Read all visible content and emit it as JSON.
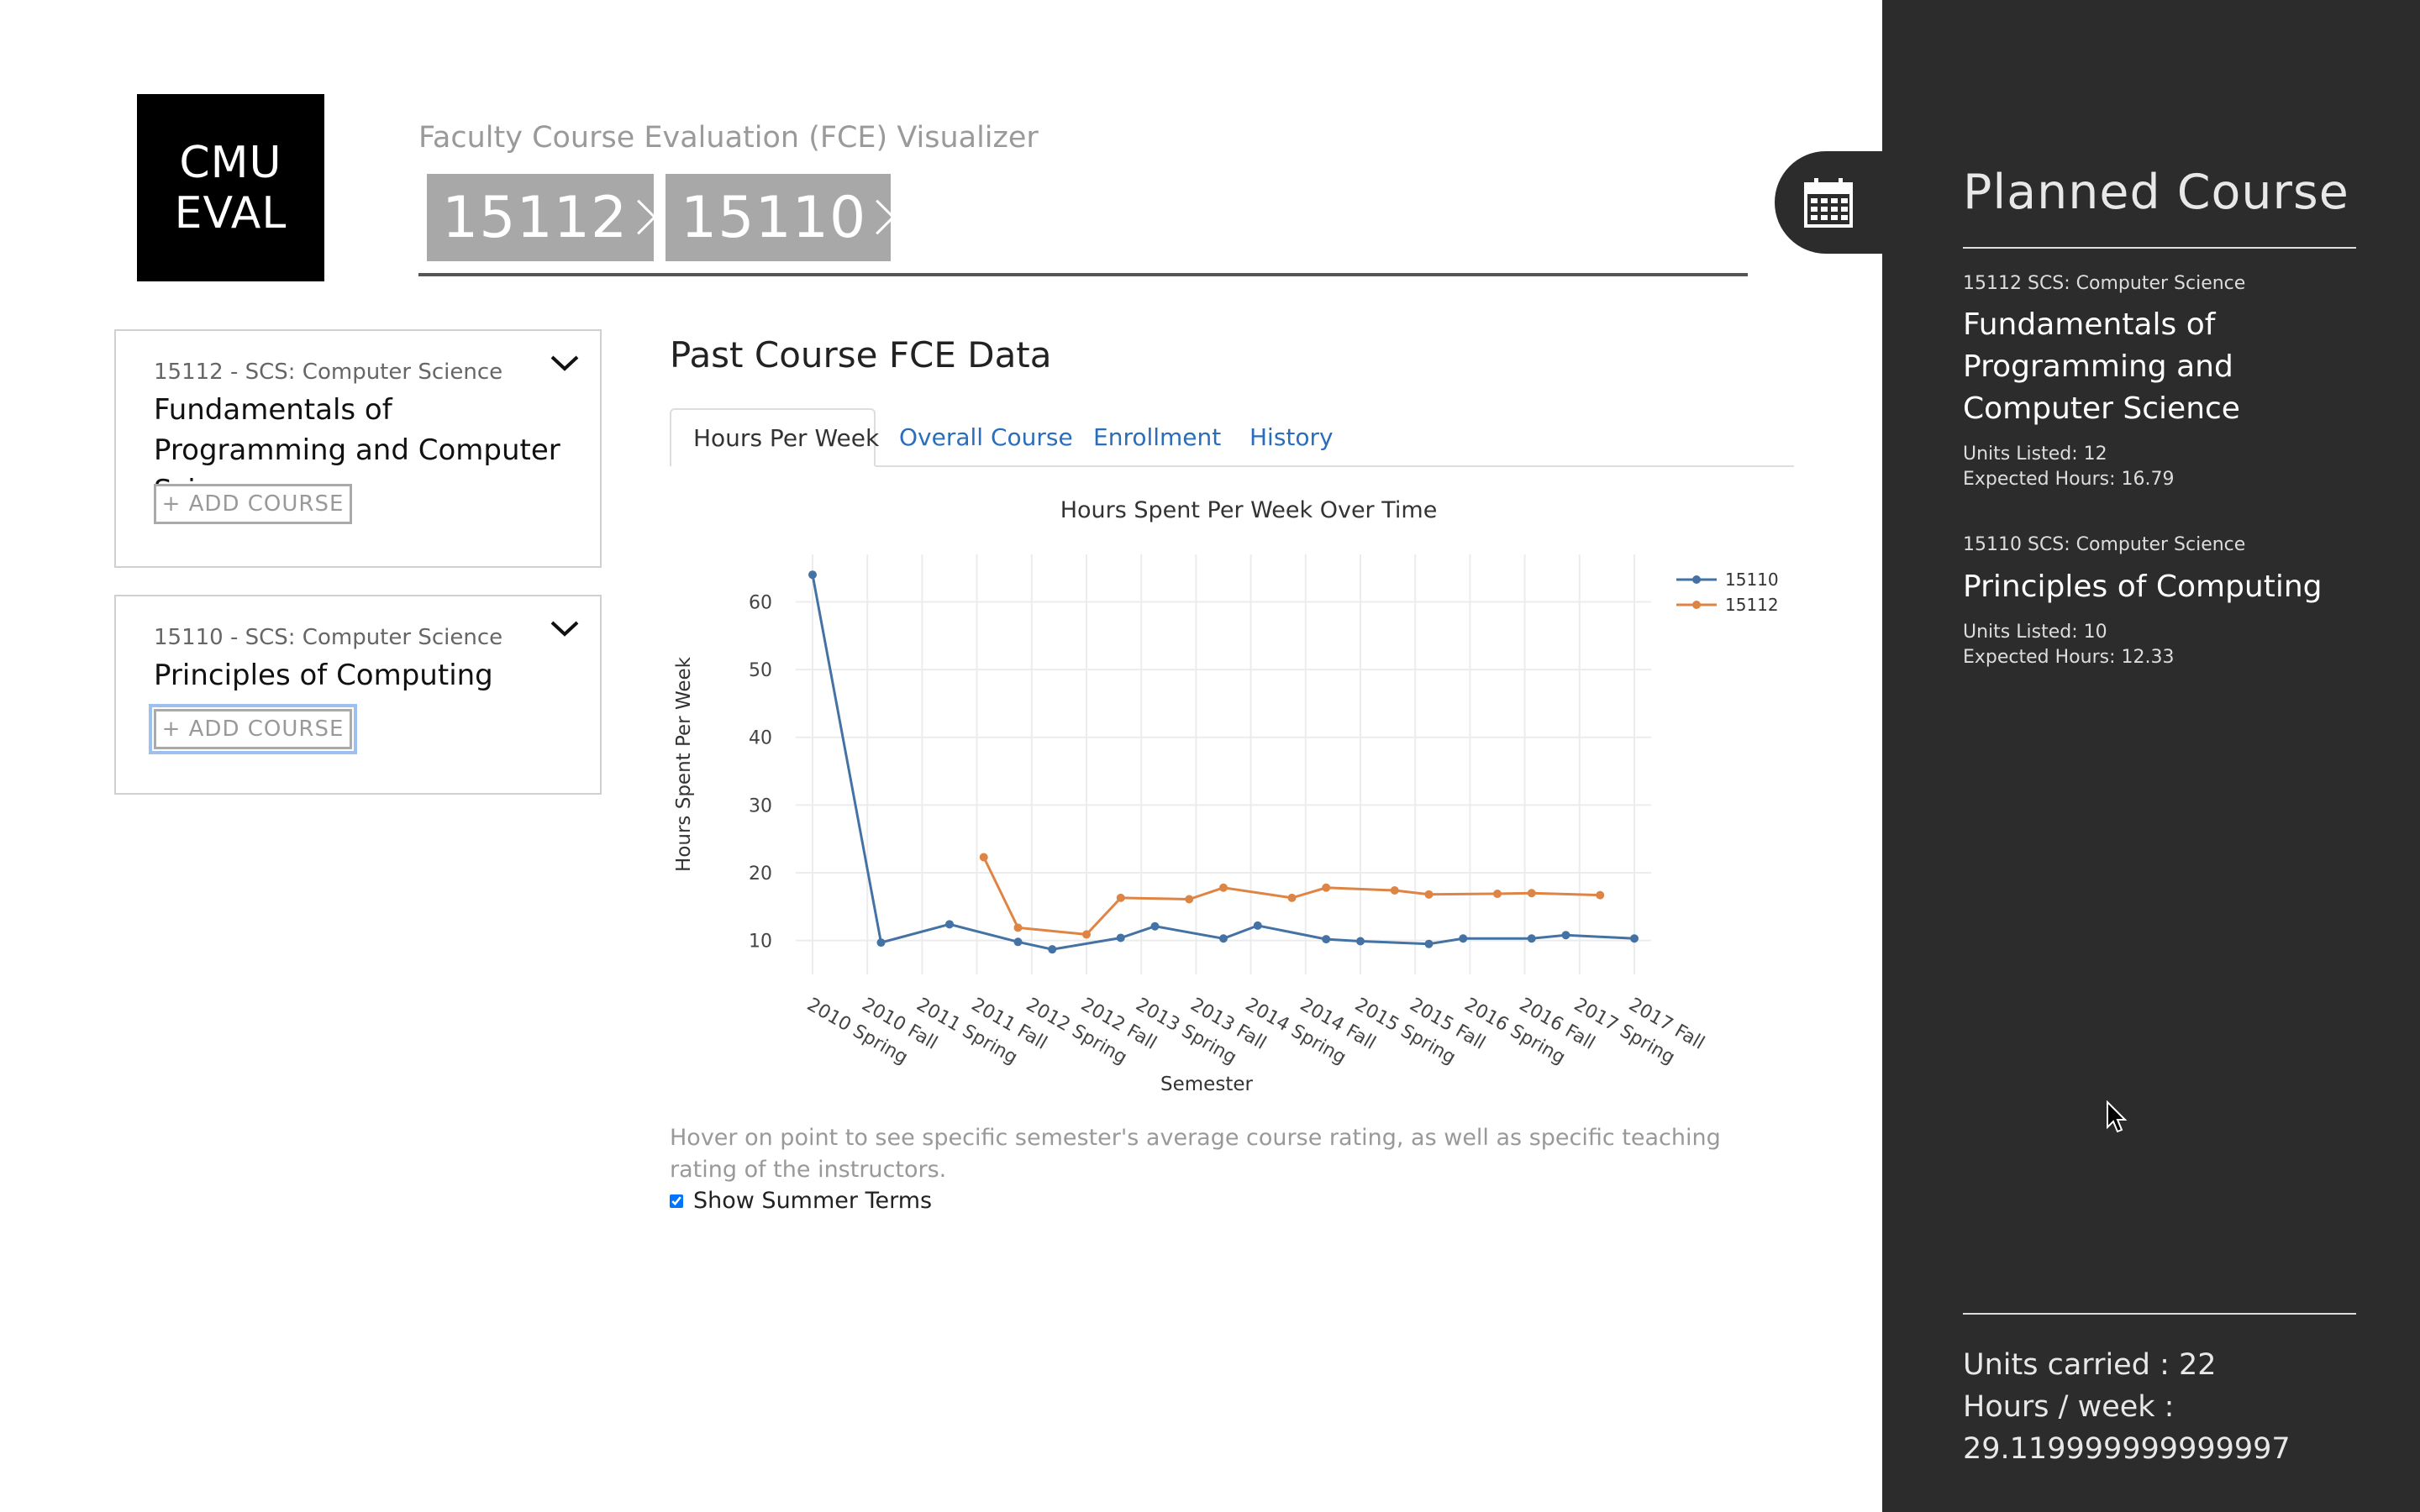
{
  "logo": {
    "line1": "CMU",
    "line2": "EVAL"
  },
  "header": {
    "title": "Faculty Course Evaluation (FCE) Visualizer",
    "chips": [
      "15112",
      "15110"
    ]
  },
  "courses": [
    {
      "dept": "15112 - SCS: Computer Science",
      "name": "Fundamentals of Programming and Computer Science",
      "add_label": "+ ADD COURSE"
    },
    {
      "dept": "15110 - SCS: Computer Science",
      "name": "Principles of Computing",
      "add_label": "+ ADD COURSE"
    }
  ],
  "main": {
    "title": "Past Course FCE Data",
    "tabs": [
      "Hours Per Week",
      "Overall Course",
      "Enrollment",
      "History"
    ],
    "active_tab": "Hours Per Week",
    "hint": "Hover on point to see specific semester's average course rating, as well as specific teaching rating of the instructors.",
    "summer_label": "Show Summer Terms",
    "summer_checked": true
  },
  "chart_data": {
    "type": "line",
    "title": "Hours Spent Per Week Over Time",
    "xlabel": "Semester",
    "ylabel": "Hours Spent Per Week",
    "x": [
      "2010 Spring",
      "2010 Fall",
      "2011 Spring",
      "2011 Fall",
      "2012 Spring",
      "2012 Fall",
      "2013 Spring",
      "2013 Fall",
      "2014 Spring",
      "2014 Fall",
      "2015 Spring",
      "2015 Fall",
      "2016 Spring",
      "2016 Fall",
      "2017 Spring",
      "2017 Fall"
    ],
    "ylim": [
      5,
      67
    ],
    "yticks": [
      10,
      20,
      30,
      40,
      50,
      60
    ],
    "grid": true,
    "legend_position": "top-right",
    "series": [
      {
        "name": "15110",
        "color": "#4472a4",
        "points": [
          [
            0,
            64
          ],
          [
            1,
            9.7
          ],
          [
            2,
            12.4
          ],
          [
            3,
            9.8
          ],
          [
            3.5,
            8.7
          ],
          [
            4.5,
            10.4
          ],
          [
            5,
            12.1
          ],
          [
            6,
            10.3
          ],
          [
            6.5,
            12.2
          ],
          [
            7.5,
            10.2
          ],
          [
            8,
            9.9
          ],
          [
            9,
            9.5
          ],
          [
            9.5,
            10.3
          ],
          [
            10.5,
            10.3
          ],
          [
            11,
            10.8
          ],
          [
            12,
            10.3
          ]
        ]
      },
      {
        "name": "15112",
        "color": "#de8444",
        "points": [
          [
            2.5,
            22.3
          ],
          [
            3,
            11.9
          ],
          [
            4,
            10.9
          ],
          [
            4.5,
            16.3
          ],
          [
            5.5,
            16.1
          ],
          [
            6,
            17.8
          ],
          [
            7,
            16.3
          ],
          [
            7.5,
            17.8
          ],
          [
            8.5,
            17.4
          ],
          [
            9,
            16.8
          ],
          [
            10,
            16.9
          ],
          [
            10.5,
            17.0
          ],
          [
            11.5,
            16.7
          ]
        ]
      }
    ]
  },
  "sidebar": {
    "title": "Planned Course",
    "courses": [
      {
        "dept": "15112 SCS: Computer Science",
        "name": "Fundamentals of Programming and Computer Science",
        "units": "Units Listed: 12",
        "hours": "Expected Hours: 16.79"
      },
      {
        "dept": "15110 SCS: Computer Science",
        "name": "Principles of Computing",
        "units": "Units Listed: 10",
        "hours": "Expected Hours: 12.33"
      }
    ],
    "units_total": "Units carried : 22",
    "hours_label": "Hours / week :",
    "hours_value": "29.119999999999997"
  },
  "colors": {
    "sidebar_bg": "#2c2c2c",
    "chip_bg": "#a8a8a8",
    "link": "#2a6ebb",
    "series_15110": "#4472a4",
    "series_15112": "#de8444"
  }
}
